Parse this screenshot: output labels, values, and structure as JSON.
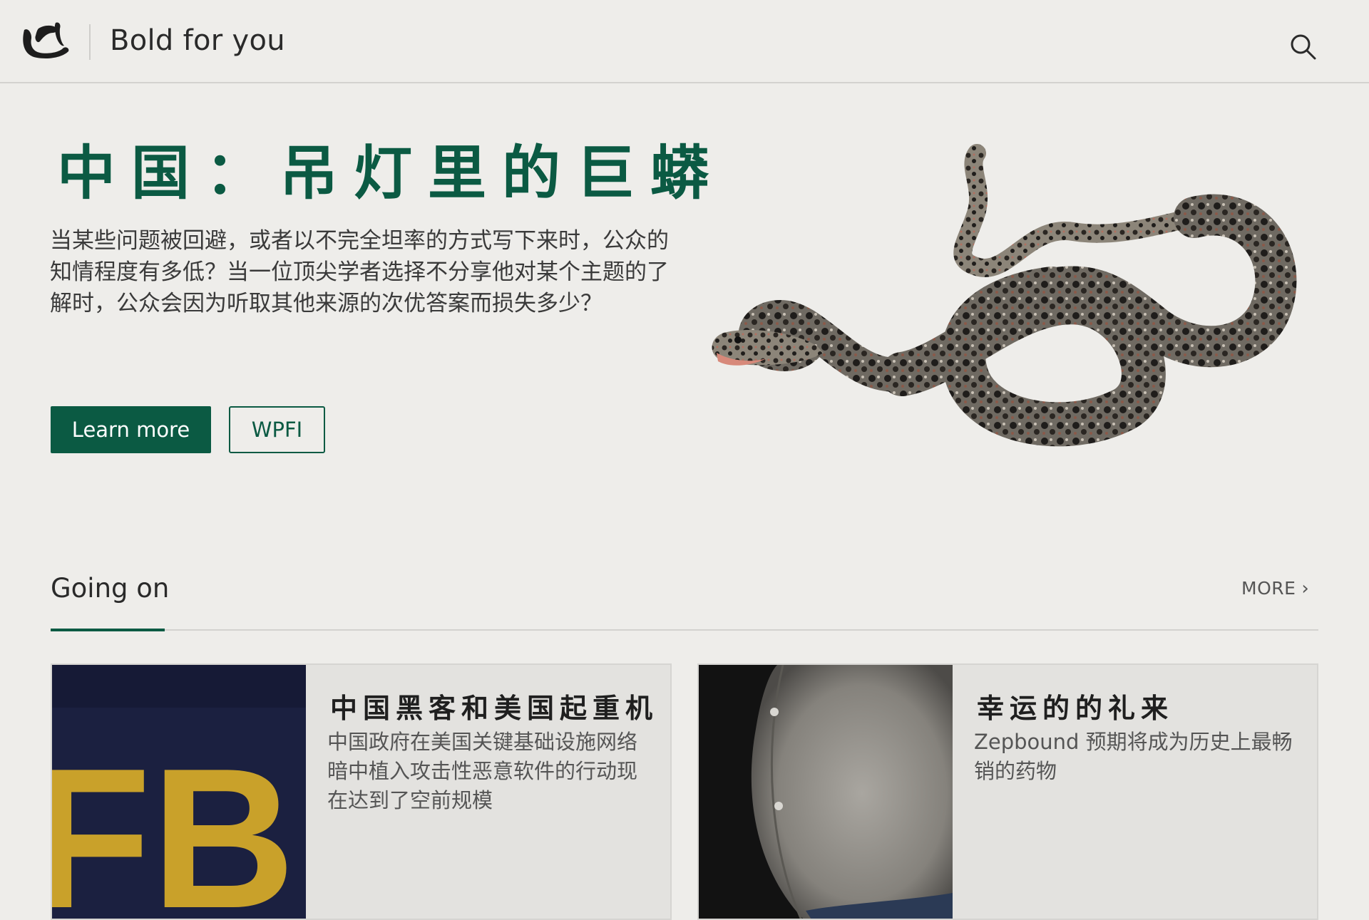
{
  "header": {
    "site_title": "Bold for you",
    "logo_icon": "brush-stroke-logo",
    "search_icon": "search-icon"
  },
  "hero": {
    "title": "中国：吊灯里的巨蟒",
    "description": "当某些问题被回避，或者以不完全坦率的方式写下来时，公众的知情程度有多低？当一位顶尖学者选择不分享他对某个主题的了解时，公众会因为听取其他来源的次优答案而损失多少？",
    "primary_button": "Learn more",
    "secondary_button": "WPFI",
    "image_subject": "snake-illustration"
  },
  "section": {
    "title": "Going on",
    "more_label": "MORE"
  },
  "cards": [
    {
      "title": "中国黑客和美国起重机",
      "description": "中国政府在美国关键基础设施网络暗中植入攻击性恶意软件的行动现在达到了空前规模",
      "image_subject": "fbi-jacket-photo",
      "image_text": "FB"
    },
    {
      "title": "幸运的的礼来",
      "description": "Zepbound 预期将成为历史上最畅销的药物",
      "image_subject": "belly-photo"
    }
  ],
  "colors": {
    "accent": "#0b5a43",
    "background": "#eeedea",
    "card_background": "#e3e2df"
  }
}
